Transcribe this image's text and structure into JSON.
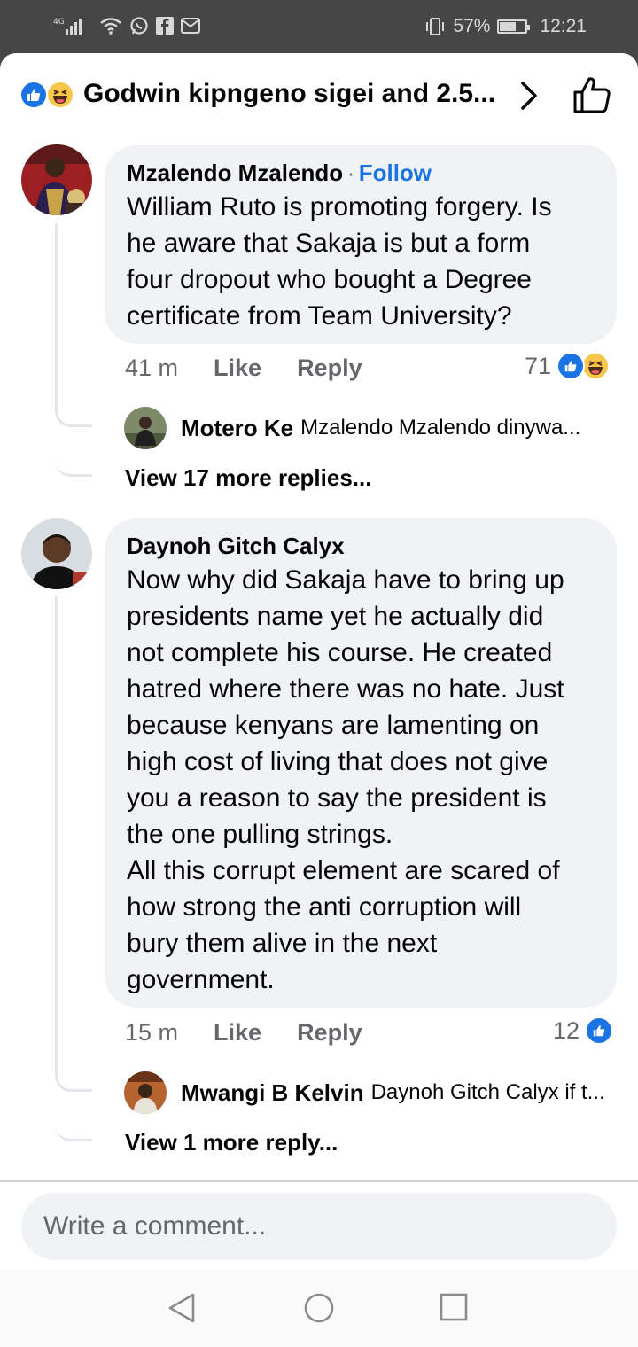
{
  "status_bar": {
    "network": "4G",
    "battery": "57%",
    "battery_level": 0.57,
    "time": "12:21"
  },
  "header": {
    "title": "Godwin kipngeno sigei and 2.5..."
  },
  "comments": [
    {
      "author": "Mzalendo Mzalendo",
      "separator": "·",
      "follow_label": "Follow",
      "text": "William Ruto is promoting forgery. Is\nhe aware that Sakaja is but a form\nfour dropout who bought a Degree\ncertificate from Team University?",
      "time": "41 m",
      "like_label": "Like",
      "reply_label": "Reply",
      "reaction_count": "71",
      "reply_preview": {
        "author": "Motero Ke",
        "snippet": "Mzalendo Mzalendo dinywa..."
      },
      "view_more": "View 17 more replies..."
    },
    {
      "author": "Daynoh Gitch Calyx",
      "text": "Now why did Sakaja have to bring up\npresidents name yet he actually did\nnot complete his course. He created\nhatred where there was no hate. Just\nbecause kenyans are lamenting on\nhigh cost of living that does not give\nyou a reason to say the president is\nthe one pulling strings.\nAll this corrupt element are scared of\nhow strong the anti corruption will\nbury them alive in the next\ngovernment.",
      "time": "15 m",
      "like_label": "Like",
      "reply_label": "Reply",
      "reaction_count": "12",
      "reply_preview": {
        "author": "Mwangi B Kelvin",
        "snippet": "Daynoh Gitch Calyx if t..."
      },
      "view_more": "View 1 more reply..."
    }
  ],
  "composer": {
    "placeholder": "Write a comment..."
  },
  "colors": {
    "accent": "#1b74e4",
    "bubble": "#f0f2f5",
    "secondary_text": "#65676b"
  }
}
